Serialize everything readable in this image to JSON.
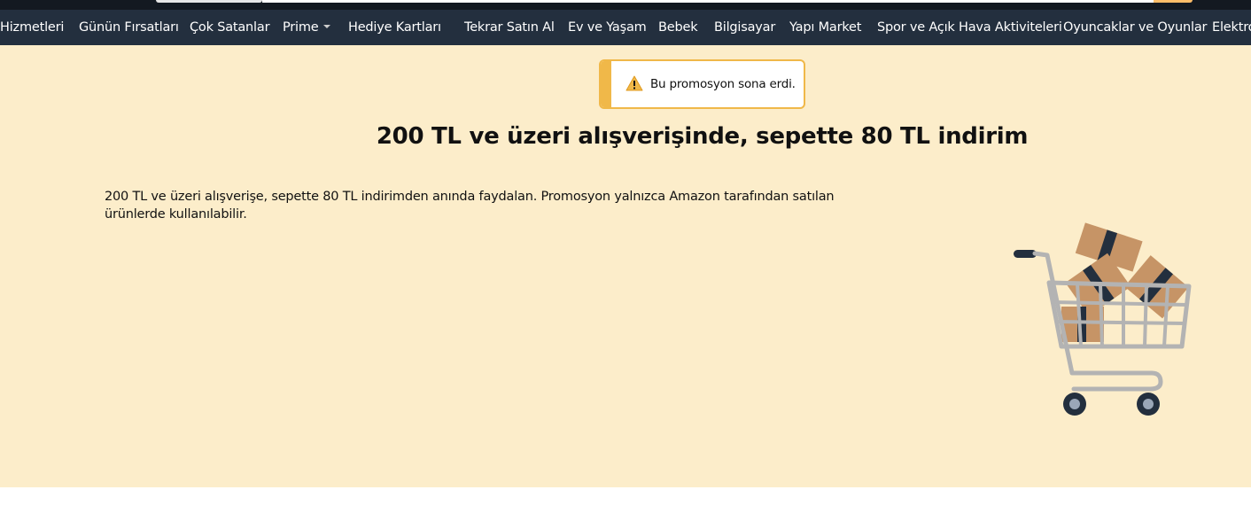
{
  "nav": {
    "items": [
      {
        "label": "Hizmetleri"
      },
      {
        "label": "Günün Fırsatları"
      },
      {
        "label": "Çok Satanlar"
      },
      {
        "label": "Prime"
      },
      {
        "label": "Hediye Kartları"
      },
      {
        "label": "Tekrar Satın Al"
      },
      {
        "label": "Ev ve Yaşam"
      },
      {
        "label": "Bebek"
      },
      {
        "label": "Bilgisayar"
      },
      {
        "label": "Yapı Market"
      },
      {
        "label": "Spor ve Açık Hava Aktiviteleri"
      },
      {
        "label": "Oyuncaklar ve Oyunlar"
      },
      {
        "label": "Elektronik"
      }
    ]
  },
  "alert": {
    "icon": "warning-icon",
    "message": "Bu promosyon sona erdi."
  },
  "promo": {
    "title": "200 TL ve üzeri alışverişinde, sepette 80 TL indirim",
    "description": "200 TL ve üzeri alışverişe, sepette 80 TL indirimden anında faydalan. Promosyon yalnızca Amazon tarafından satılan ürünlerde kullanılabilir."
  },
  "colors": {
    "nav_bg": "#232f3e",
    "top_bg": "#131921",
    "page_bg": "#fcedca",
    "alert_accent": "#f0b849"
  }
}
